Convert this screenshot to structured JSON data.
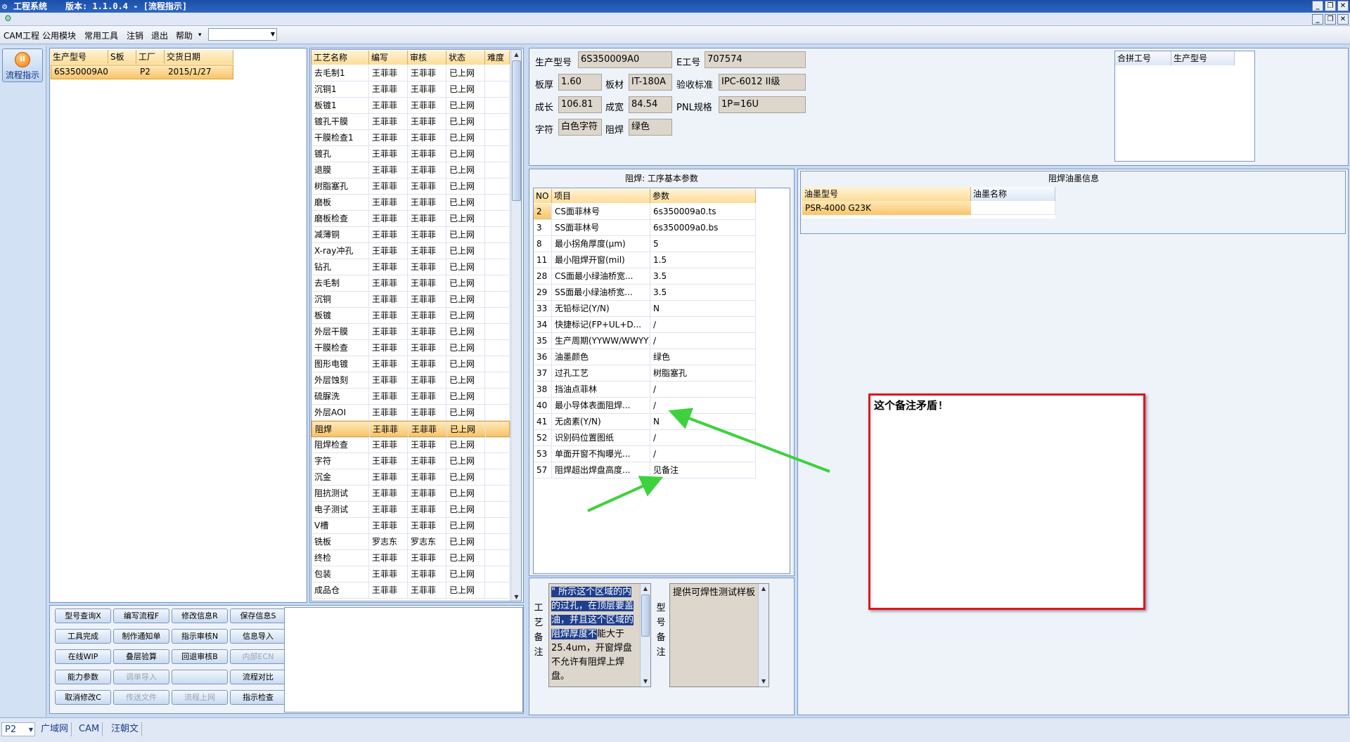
{
  "window": {
    "app_title": "工程系统",
    "version_text": "版本: 1.1.0.4 - [流程指示]",
    "controls": [
      "_",
      "❐",
      "✕"
    ],
    "mdi_controls": [
      "_",
      "❐",
      "✕"
    ]
  },
  "menu": [
    "CAM工程",
    "公用模块",
    "常用工具",
    "注销",
    "退出",
    "帮助"
  ],
  "sidebar": {
    "flow_label": "流程指示"
  },
  "order_table": {
    "headers": [
      "生产型号",
      "S板",
      "工厂",
      "交货日期"
    ],
    "rows": [
      [
        "6S350009A0",
        "",
        "P2",
        "2015/1/27"
      ]
    ]
  },
  "process_table": {
    "headers": [
      "工艺名称",
      "编写",
      "审核",
      "状态",
      "难度"
    ],
    "selected_index": 22,
    "rows": [
      [
        "去毛制1",
        "王菲菲",
        "王菲菲",
        "已上网",
        ""
      ],
      [
        "沉铜1",
        "王菲菲",
        "王菲菲",
        "已上网",
        ""
      ],
      [
        "板镀1",
        "王菲菲",
        "王菲菲",
        "已上网",
        ""
      ],
      [
        "镀孔干膜",
        "王菲菲",
        "王菲菲",
        "已上网",
        ""
      ],
      [
        "干膜检查1",
        "王菲菲",
        "王菲菲",
        "已上网",
        ""
      ],
      [
        "镀孔",
        "王菲菲",
        "王菲菲",
        "已上网",
        ""
      ],
      [
        "退膜",
        "王菲菲",
        "王菲菲",
        "已上网",
        ""
      ],
      [
        "树脂塞孔",
        "王菲菲",
        "王菲菲",
        "已上网",
        ""
      ],
      [
        "磨板",
        "王菲菲",
        "王菲菲",
        "已上网",
        ""
      ],
      [
        "磨板检查",
        "王菲菲",
        "王菲菲",
        "已上网",
        ""
      ],
      [
        "减薄铜",
        "王菲菲",
        "王菲菲",
        "已上网",
        ""
      ],
      [
        "X-ray冲孔",
        "王菲菲",
        "王菲菲",
        "已上网",
        ""
      ],
      [
        "钻孔",
        "王菲菲",
        "王菲菲",
        "已上网",
        ""
      ],
      [
        "去毛制",
        "王菲菲",
        "王菲菲",
        "已上网",
        ""
      ],
      [
        "沉铜",
        "王菲菲",
        "王菲菲",
        "已上网",
        ""
      ],
      [
        "板镀",
        "王菲菲",
        "王菲菲",
        "已上网",
        ""
      ],
      [
        "外层干膜",
        "王菲菲",
        "王菲菲",
        "已上网",
        ""
      ],
      [
        "干膜检查",
        "王菲菲",
        "王菲菲",
        "已上网",
        ""
      ],
      [
        "图形电镀",
        "王菲菲",
        "王菲菲",
        "已上网",
        ""
      ],
      [
        "外层蚀刻",
        "王菲菲",
        "王菲菲",
        "已上网",
        ""
      ],
      [
        "硫脲洗",
        "王菲菲",
        "王菲菲",
        "已上网",
        ""
      ],
      [
        "外层AOI",
        "王菲菲",
        "王菲菲",
        "已上网",
        ""
      ],
      [
        "阻焊",
        "王菲菲",
        "王菲菲",
        "已上网",
        ""
      ],
      [
        "阻焊检查",
        "王菲菲",
        "王菲菲",
        "已上网",
        ""
      ],
      [
        "字符",
        "王菲菲",
        "王菲菲",
        "已上网",
        ""
      ],
      [
        "沉金",
        "王菲菲",
        "王菲菲",
        "已上网",
        ""
      ],
      [
        "阻抗测试",
        "王菲菲",
        "王菲菲",
        "已上网",
        ""
      ],
      [
        "电子测试",
        "王菲菲",
        "王菲菲",
        "已上网",
        ""
      ],
      [
        "V槽",
        "王菲菲",
        "王菲菲",
        "已上网",
        ""
      ],
      [
        "铣板",
        "罗志东",
        "罗志东",
        "已上网",
        ""
      ],
      [
        "终检",
        "王菲菲",
        "王菲菲",
        "已上网",
        ""
      ],
      [
        "包装",
        "王菲菲",
        "王菲菲",
        "已上网",
        ""
      ],
      [
        "成品仓",
        "王菲菲",
        "王菲菲",
        "已上网",
        ""
      ]
    ]
  },
  "buttons": [
    {
      "label": "型号查询X",
      "enabled": true
    },
    {
      "label": "编写流程F",
      "enabled": true
    },
    {
      "label": "修改信息R",
      "enabled": true
    },
    {
      "label": "保存信息S",
      "enabled": true
    },
    {
      "label": "工具完成",
      "enabled": true
    },
    {
      "label": "制作通知单",
      "enabled": true
    },
    {
      "label": "指示审核N",
      "enabled": true
    },
    {
      "label": "信息导入",
      "enabled": true
    },
    {
      "label": "在线WIP",
      "enabled": true
    },
    {
      "label": "叠层验算",
      "enabled": true
    },
    {
      "label": "回退审核B",
      "enabled": true
    },
    {
      "label": "内部ECN",
      "enabled": false
    },
    {
      "label": "能力参数",
      "enabled": true
    },
    {
      "label": "调单导入",
      "enabled": false
    },
    {
      "label": "",
      "enabled": true
    },
    {
      "label": "流程对比",
      "enabled": true
    },
    {
      "label": "取消修改C",
      "enabled": true
    },
    {
      "label": "传送文件",
      "enabled": false
    },
    {
      "label": "流程上网",
      "enabled": false
    },
    {
      "label": "指示检查",
      "enabled": true
    }
  ],
  "info": {
    "model_label": "生产型号",
    "model_value": "6S350009A0",
    "e_label": "E工号",
    "e_value": "707574",
    "thickness_label": "板厚",
    "thickness_value": "1.60",
    "material_label": "板材",
    "material_value": "IT-180A",
    "standard_label": "验收标准",
    "standard_value": "IPC-6012 II级",
    "length_label": "成长",
    "length_value": "106.81",
    "width_label": "成宽",
    "width_value": "84.54",
    "pnl_label": "PNL规格",
    "pnl_value": "1P=16U",
    "char_label": "字符",
    "char_value": "白色字符",
    "mask_label": "阻焊",
    "mask_value": "绿色"
  },
  "merge_table": {
    "headers": [
      "合拼工号",
      "生产型号"
    ]
  },
  "params": {
    "title": "阻焊: 工序基本参数",
    "headers": [
      "NO",
      "项目",
      "参数"
    ],
    "selected_index": 0,
    "rows": [
      [
        "2",
        "CS面菲林号",
        "6s350009a0.ts"
      ],
      [
        "3",
        "SS面菲林号",
        "6s350009a0.bs"
      ],
      [
        "8",
        "最小拐角厚度(μm)",
        "5"
      ],
      [
        "11",
        "最小阻焊开窗(mil)",
        "1.5"
      ],
      [
        "28",
        "CS面最小绿油桥宽...",
        "3.5"
      ],
      [
        "29",
        "SS面最小绿油桥宽...",
        "3.5"
      ],
      [
        "33",
        "无铅标记(Y/N)",
        "N"
      ],
      [
        "34",
        "快捷标记(FP+UL+D...",
        "/"
      ],
      [
        "35",
        "生产周期(YYWW/WWYY)",
        "/"
      ],
      [
        "36",
        "油墨颜色",
        "绿色"
      ],
      [
        "37",
        "过孔工艺",
        "树脂塞孔"
      ],
      [
        "38",
        "挡油点菲林",
        "/"
      ],
      [
        "40",
        "最小导体表面阻焊...",
        "/"
      ],
      [
        "41",
        "无卤素(Y/N)",
        "N"
      ],
      [
        "52",
        "识别码位置图纸",
        "/"
      ],
      [
        "53",
        "单面开窗不掏曝光...",
        "/"
      ],
      [
        "57",
        "阻焊超出焊盘高度...",
        "见备注"
      ]
    ]
  },
  "ink": {
    "title": "阻焊油墨信息",
    "headers": [
      "油墨型号",
      "油墨名称"
    ],
    "rows": [
      [
        "PSR-4000 G23K",
        ""
      ]
    ]
  },
  "notes": {
    "process_label": [
      "工",
      "艺",
      "备",
      "注"
    ],
    "process_selected_text": "\" 所示这个区域的内的过孔，在顶层要盖油，并且这个区域的阻焊厚度不",
    "process_rest_text": "能大于25.4um，开窗焊盘不允许有阻焊上焊盘。",
    "model_label": [
      "型",
      "号",
      "备",
      "注"
    ],
    "model_text": "提供可焊性测试样板"
  },
  "annotation": {
    "text": "这个备注矛盾!",
    "box_color": "#e0141e",
    "arrow_color": "#3dd23d"
  },
  "statusbar": {
    "factory": "P2",
    "items": [
      "广域网",
      "CAM",
      "汪朝文"
    ]
  }
}
